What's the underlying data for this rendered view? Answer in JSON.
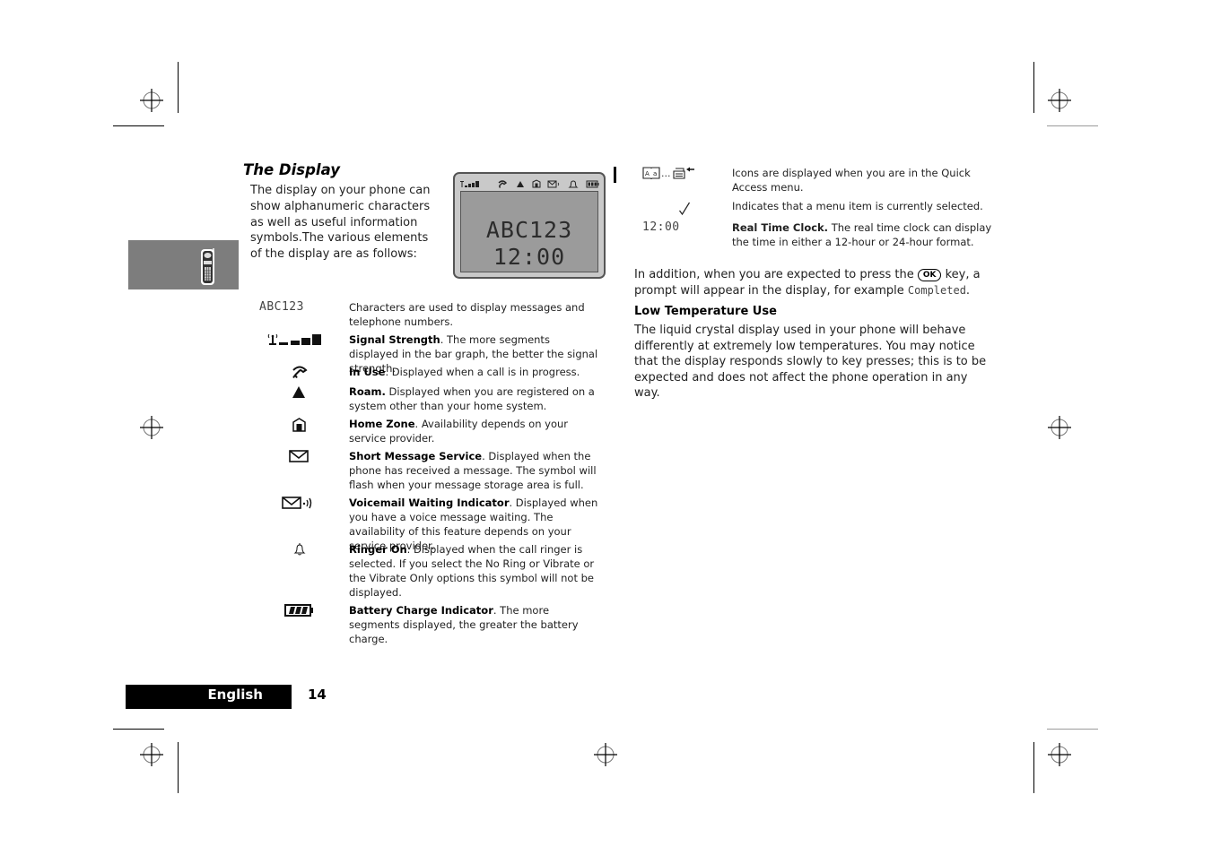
{
  "page": {
    "title": "The Display",
    "intro": "The display on your phone can show alphanumeric characters as well as useful information symbols.The various elements of the display are as follows:",
    "lcd": {
      "line1": "ABC123",
      "line2": "12:00",
      "status_icons": [
        "signal-strength-icon",
        "in-use-icon",
        "roam-icon",
        "home-zone-icon",
        "voicemail-icon",
        "ringer-icon",
        "battery-icon"
      ]
    },
    "side_tab_icon": "phone-icon",
    "elements": [
      {
        "symbol_text": "ABC123",
        "icon": "characters",
        "bold": "",
        "text": "Characters are used to display messages and telephone numbers."
      },
      {
        "icon": "signal-strength-icon",
        "bold": "Signal Strength",
        "text": ". The more segments displayed in the bar graph, the better the signal strength."
      },
      {
        "icon": "in-use-icon",
        "bold": "In Use",
        "text": ". Displayed when a call is in progress."
      },
      {
        "icon": "roam-icon",
        "bold": "Roam.",
        "text": " Displayed when you are registered on a system other than your home system."
      },
      {
        "icon": "home-zone-icon",
        "bold": "Home Zone",
        "text": ". Availability depends on your service provider."
      },
      {
        "icon": "envelope-icon",
        "bold": "Short Message Service",
        "text": ". Displayed when the phone has received a message. The symbol will flash when your message storage area is full."
      },
      {
        "icon": "voicemail-icon",
        "bold": "Voicemail Waiting Indicator",
        "text": ". Displayed when you have a voice message waiting. The availability of this feature depends on your service provider."
      },
      {
        "icon": "bell-icon",
        "bold": "Ringer On",
        "text": ". Displayed when the call ringer is selected. If you select the No Ring or Vibrate or the Vibrate Only options this symbol will not be displayed."
      },
      {
        "icon": "battery-icon",
        "bold": "Battery Charge Indicator",
        "text": ". The more segments displayed, the greater the battery charge."
      }
    ],
    "right_elements": [
      {
        "icon": "quick-access-icons",
        "ellipsis": "...",
        "bold": "",
        "text": "Icons are displayed when you are in the Quick Access menu."
      },
      {
        "icon": "checkmark-icon",
        "bold": "",
        "text": "Indicates that a menu item is currently selected."
      },
      {
        "symbol_text": "12:00",
        "icon": "clock",
        "bold": "Real Time Clock.",
        "text": " The real time clock can display the time in either a 12-hour or 24-hour format."
      }
    ],
    "para1": {
      "before": "In addition, when you are expected to press the ",
      "key": "OK",
      "middle": " key, a prompt will appear in the display, for example ",
      "example": "Completed",
      "after": "."
    },
    "subheading": "Low Temperature Use",
    "para2": "The liquid crystal display used in your phone will behave differently at extremely low temperatures. You may notice that the display responds slowly to key presses; this is to be expected and does not affect the phone operation in any way."
  },
  "footer": {
    "language": "English",
    "page_number": "14"
  }
}
